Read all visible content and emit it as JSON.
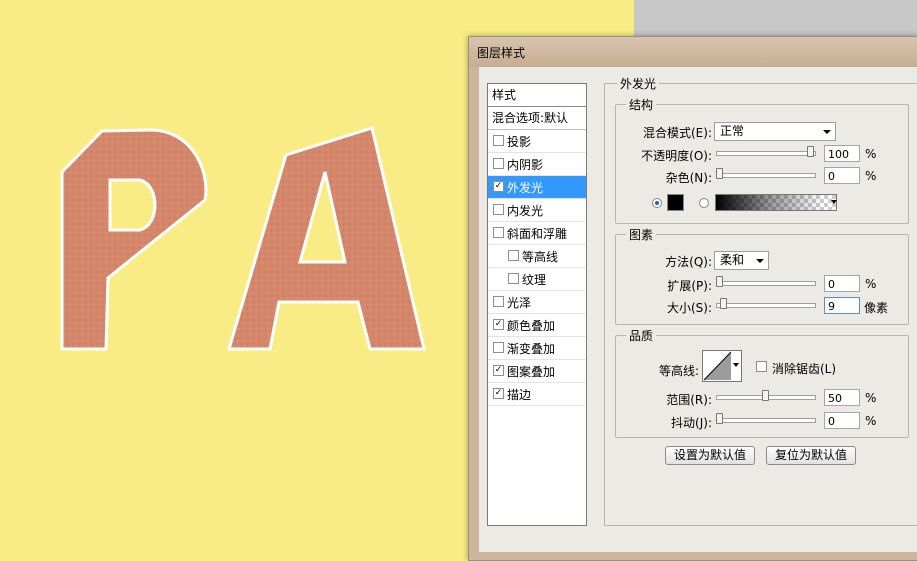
{
  "dialog": {
    "title": "图层样式"
  },
  "style_list": {
    "header": "样式",
    "blend_label": "混合选项:默认",
    "items": [
      {
        "label": "投影",
        "checked": false,
        "active": false,
        "indent": false
      },
      {
        "label": "内阴影",
        "checked": false,
        "active": false,
        "indent": false
      },
      {
        "label": "外发光",
        "checked": true,
        "active": true,
        "indent": false
      },
      {
        "label": "内发光",
        "checked": false,
        "active": false,
        "indent": false
      },
      {
        "label": "斜面和浮雕",
        "checked": false,
        "active": false,
        "indent": false
      },
      {
        "label": "等高线",
        "checked": false,
        "active": false,
        "indent": true
      },
      {
        "label": "纹理",
        "checked": false,
        "active": false,
        "indent": true
      },
      {
        "label": "光泽",
        "checked": false,
        "active": false,
        "indent": false
      },
      {
        "label": "颜色叠加",
        "checked": true,
        "active": false,
        "indent": false
      },
      {
        "label": "渐变叠加",
        "checked": false,
        "active": false,
        "indent": false
      },
      {
        "label": "图案叠加",
        "checked": true,
        "active": false,
        "indent": false
      },
      {
        "label": "描边",
        "checked": true,
        "active": false,
        "indent": false
      }
    ]
  },
  "outer_glow": {
    "title": "外发光",
    "structure": {
      "title": "结构",
      "blend_mode_label": "混合模式(E):",
      "blend_mode_value": "正常",
      "opacity_label": "不透明度(O):",
      "opacity_value": "100",
      "opacity_fraction": 1.0,
      "noise_label": "杂色(N):",
      "noise_value": "0",
      "noise_fraction": 0.0,
      "percent": "%"
    },
    "elements": {
      "title": "图素",
      "technique_label": "方法(Q):",
      "technique_value": "柔和",
      "spread_label": "扩展(P):",
      "spread_value": "0",
      "spread_fraction": 0.0,
      "size_label": "大小(S):",
      "size_value": "9",
      "size_unit": "像素",
      "size_fraction": 0.04,
      "percent": "%"
    },
    "quality": {
      "title": "品质",
      "contour_label": "等高线:",
      "antialias_label": "消除锯齿(L)",
      "antialias_checked": false,
      "range_label": "范围(R):",
      "range_value": "50",
      "range_fraction": 0.5,
      "jitter_label": "抖动(J):",
      "jitter_value": "0",
      "jitter_fraction": 0.0,
      "percent": "%"
    },
    "buttons": {
      "make_default": "设置为默认值",
      "reset_default": "复位为默认值"
    }
  },
  "colors": {
    "canvas_bg": "#f9ec85",
    "letter_fill": "#d4876a",
    "letter_stroke": "#ffffff",
    "active_row": "#3399ff"
  }
}
